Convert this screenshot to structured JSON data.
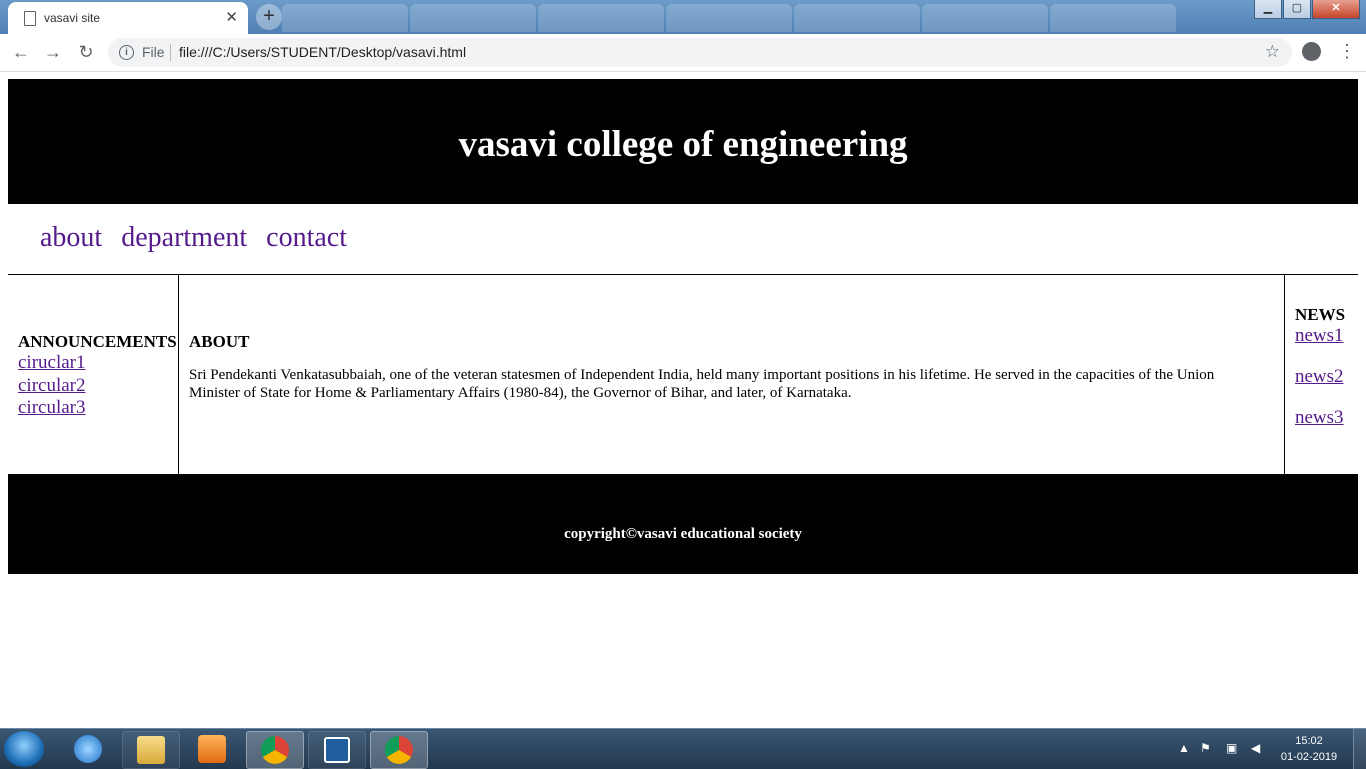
{
  "browser": {
    "tab_title": "vasavi site",
    "omnibox_scheme": "File",
    "url": "file:///C:/Users/STUDENT/Desktop/vasavi.html"
  },
  "page": {
    "header_title": "vasavi college of engineering",
    "nav": [
      "about",
      "department",
      "contact"
    ],
    "announcements": {
      "heading": "ANNOUNCEMENTS",
      "items": [
        "ciruclar1 ",
        "circular2 ",
        "circular3 "
      ]
    },
    "about": {
      "heading": "ABOUT",
      "text": "Sri Pendekanti Venkatasubbaiah, one of the veteran statesmen of Independent India, held many important positions in his lifetime. He served in the capacities of the Union Minister of State for Home & Parliamentary Affairs (1980-84), the Governor of Bihar, and later, of Karnataka."
    },
    "news": {
      "heading": "NEWS",
      "items": [
        "news1",
        "news2",
        "news3"
      ]
    },
    "footer": "copyright©vasavi educational society"
  },
  "taskbar": {
    "time": "15:02",
    "date": "01-02-2019"
  }
}
